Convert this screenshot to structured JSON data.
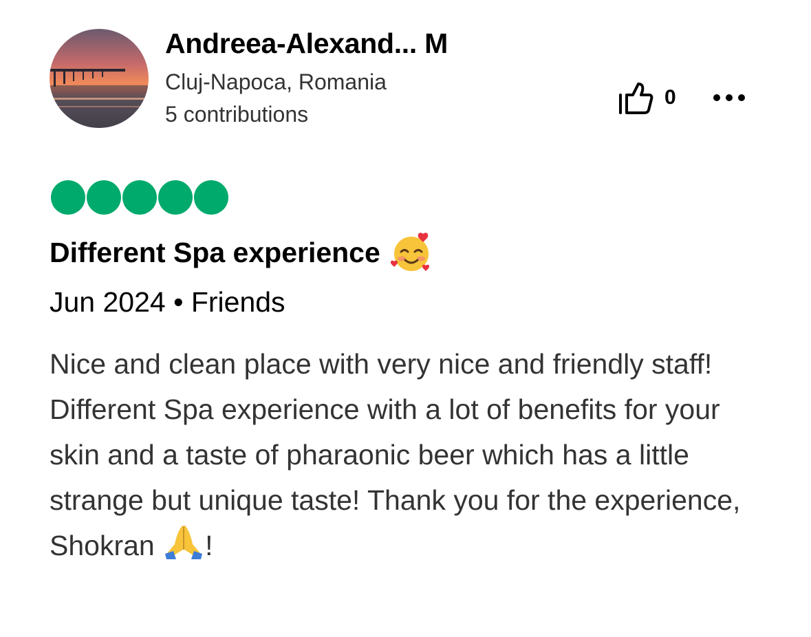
{
  "reviewer": {
    "name": "Andreea-Alexand... M",
    "location": "Cluj-Napoca, Romania",
    "contributions": "5 contributions",
    "avatar_icon": "sunset-pier-photo"
  },
  "actions": {
    "helpful_count": "0",
    "helpful_icon": "thumbs-up-icon",
    "more_icon": "more-options-icon"
  },
  "rating": {
    "value": 5,
    "max": 5,
    "color": "#00aa6c"
  },
  "review": {
    "title": "Different Spa experience",
    "title_emoji": "smiling-face-with-hearts-emoji",
    "date_line": "Jun 2024 • Friends",
    "body": "Nice and clean place with very nice and friendly staff! Different Spa experience with a lot of benefits for your skin and a taste of pharaonic beer which has a little strange but unique taste! Thank you for the experience, Shokran",
    "body_emoji": "folded-hands-emoji",
    "body_end": "!"
  }
}
